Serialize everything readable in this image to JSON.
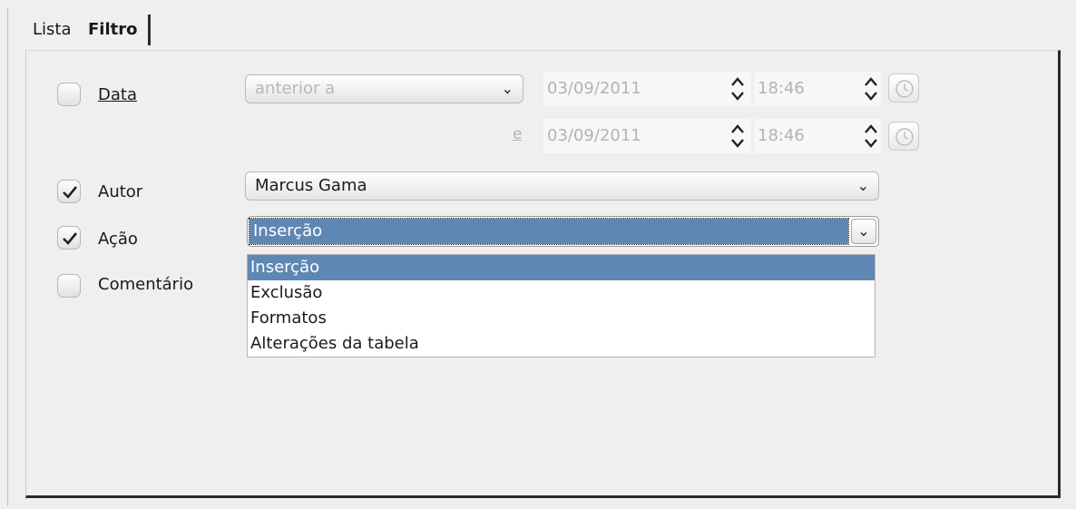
{
  "tabs": [
    {
      "label": "Lista",
      "active": false
    },
    {
      "label": "Filtro",
      "active": true
    }
  ],
  "data_row": {
    "checked": false,
    "label": "Data",
    "condition": "anterior a",
    "date1": "03/09/2011",
    "time1": "18:46",
    "and_label": "e",
    "date2": "03/09/2011",
    "time2": "18:46"
  },
  "autor_row": {
    "checked": true,
    "label": "Autor",
    "value": "Marcus Gama"
  },
  "acao_row": {
    "checked": true,
    "label": "Ação",
    "value": "Inserção",
    "options": [
      "Inserção",
      "Exclusão",
      "Formatos",
      "Alterações da tabela"
    ],
    "selected_index": 0
  },
  "comentario_row": {
    "checked": false,
    "label": "Comentário"
  },
  "colors": {
    "selection": "#5f87b4",
    "background": "#efefef"
  }
}
